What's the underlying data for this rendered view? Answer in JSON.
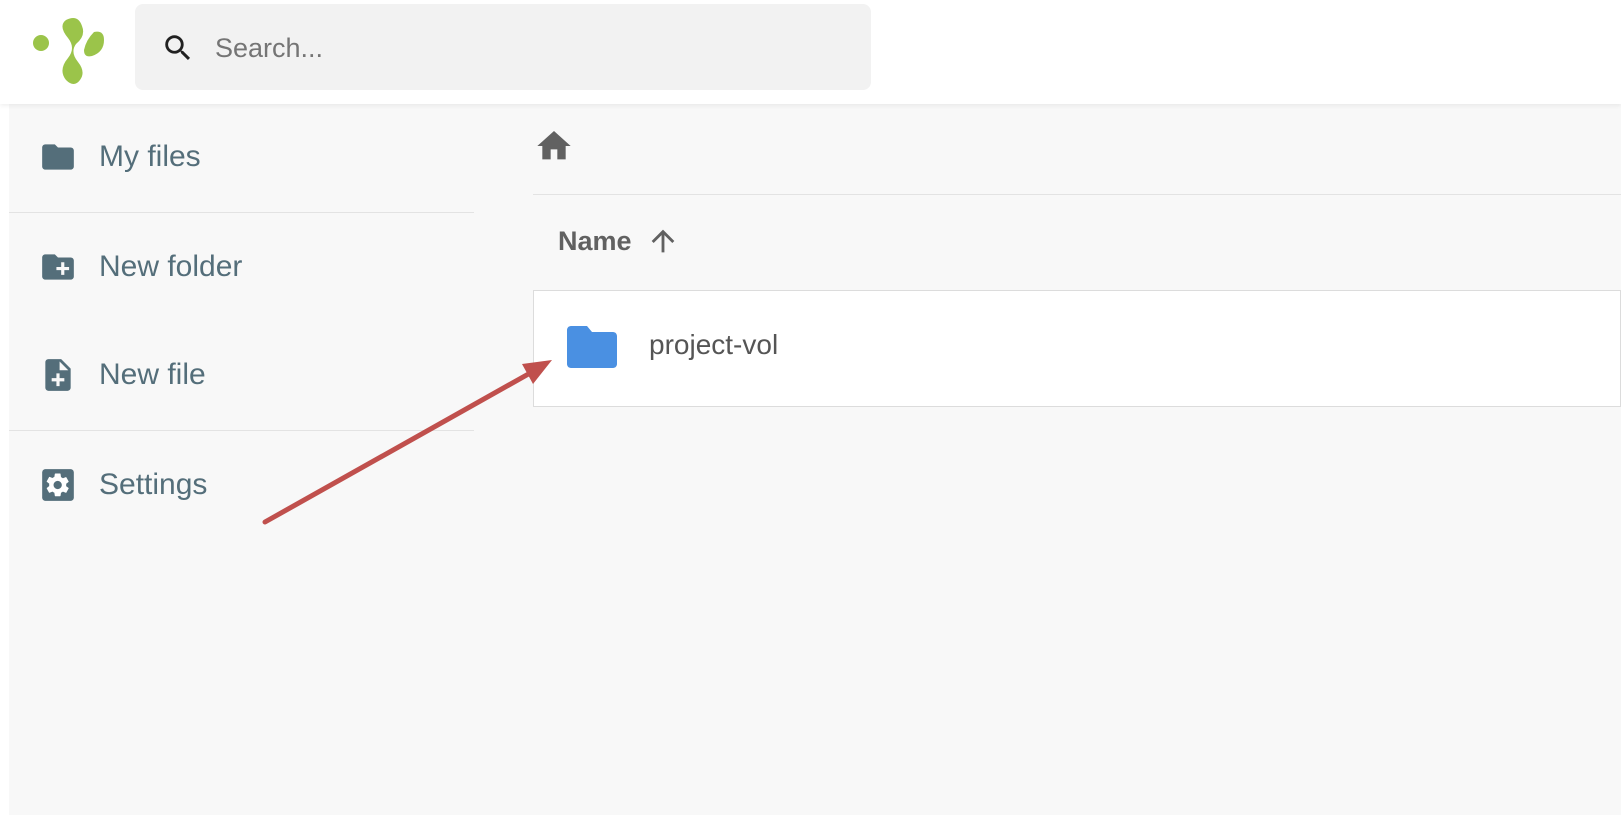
{
  "colors": {
    "logo_green": "#9bc44a",
    "sidebar_text": "#546e7a",
    "folder_blue": "#4a90e2",
    "annotation_arrow": "#c0504d"
  },
  "header": {
    "logo_icon": "app-logo",
    "search": {
      "icon": "search-icon",
      "placeholder": "Search..."
    }
  },
  "sidebar": {
    "items": [
      {
        "icon": "folder-icon",
        "label": "My files"
      },
      {
        "icon": "create-folder-icon",
        "label": "New folder"
      },
      {
        "icon": "note-add-icon",
        "label": "New file"
      },
      {
        "icon": "settings-icon",
        "label": "Settings"
      }
    ]
  },
  "main": {
    "breadcrumb": {
      "home_icon": "home-icon"
    },
    "table": {
      "columns": [
        {
          "label": "Name",
          "sort": "ascending",
          "sort_icon": "arrow-up-icon"
        }
      ],
      "rows": [
        {
          "icon": "folder-icon",
          "name": "project-vol"
        }
      ]
    }
  },
  "annotation": {
    "type": "arrow",
    "points_to": "project-vol"
  }
}
